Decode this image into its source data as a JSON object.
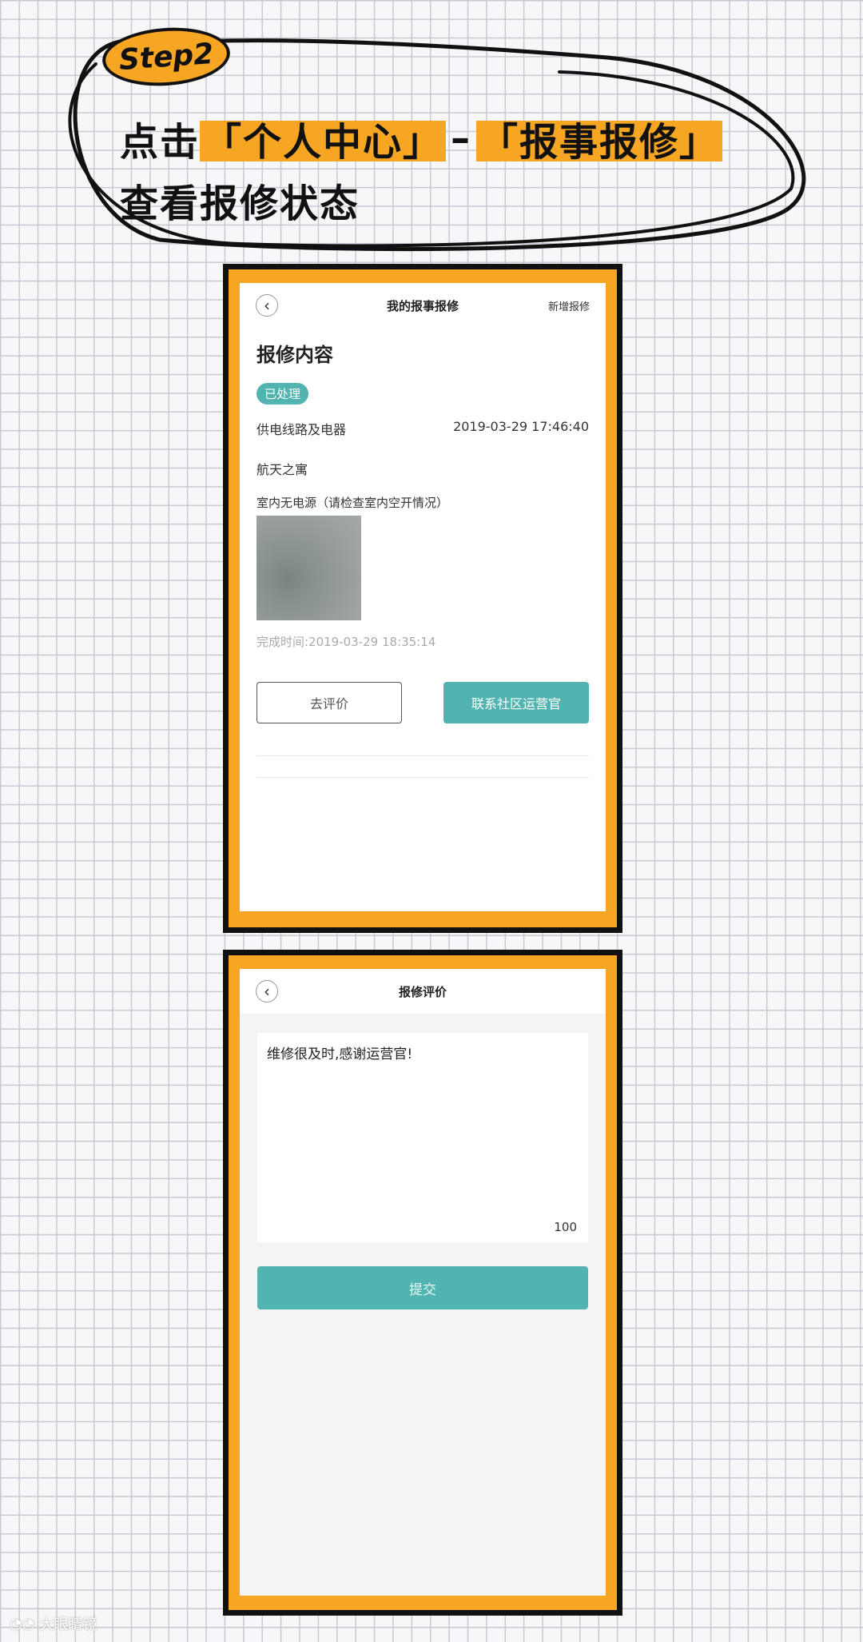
{
  "header": {
    "step_label": "Step2",
    "line1_prefix": "点击",
    "line1_h1": "「个人中心」",
    "line1_sep": "–",
    "line1_h2": "「报事报修」",
    "line2": "查看报修状态",
    "accent_color": "#f6a623"
  },
  "screen1": {
    "nav_title": "我的报事报修",
    "nav_action": "新增报修",
    "back_icon": "chevron-left-icon",
    "section_title": "报修内容",
    "status_badge": "已处理",
    "category": "供电线路及电器",
    "datetime": "2019-03-29 17:46:40",
    "location": "航天之寓",
    "description": "室内无电源（请检查室内空开情况）",
    "completed_time": "完成时间:2019-03-29 18:35:14",
    "btn_review": "去评价",
    "btn_contact": "联系社区运营官",
    "accent_color": "#52b4b1"
  },
  "screen2": {
    "nav_title": "报修评价",
    "back_icon": "chevron-left-icon",
    "review_text": "维修很及时,感谢运营官!",
    "char_count": "100",
    "submit_label": "提交"
  },
  "watermark": {
    "text": "大眼睛镜"
  }
}
